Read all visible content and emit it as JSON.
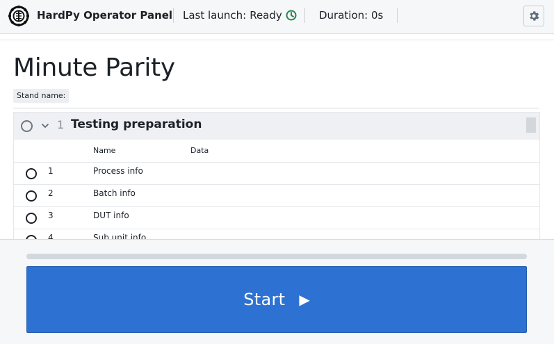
{
  "header": {
    "app_title": "HardPy Operator Panel",
    "last_launch_label": "Last launch:",
    "last_launch_status": "Ready",
    "duration": "Duration: 0s"
  },
  "page": {
    "title": "Minute Parity",
    "stand_name_label": "Stand name:"
  },
  "test_group": {
    "number": "1",
    "name": "Testing preparation",
    "columns": {
      "name": "Name",
      "data": "Data"
    },
    "rows": [
      {
        "num": "1",
        "name": "Process info"
      },
      {
        "num": "2",
        "name": "Batch info"
      },
      {
        "num": "3",
        "name": "DUT info"
      },
      {
        "num": "4",
        "name": "Sub unit info"
      }
    ]
  },
  "controls": {
    "start_label": "Start",
    "progress": 0
  },
  "colors": {
    "accent": "#2d72d2",
    "ready_green": "#238551"
  },
  "icons": {
    "logo": "hardpy-logo-icon",
    "status": "clock-icon",
    "settings": "gear-icon",
    "chevron": "chevron-down-icon",
    "play": "play-icon"
  }
}
